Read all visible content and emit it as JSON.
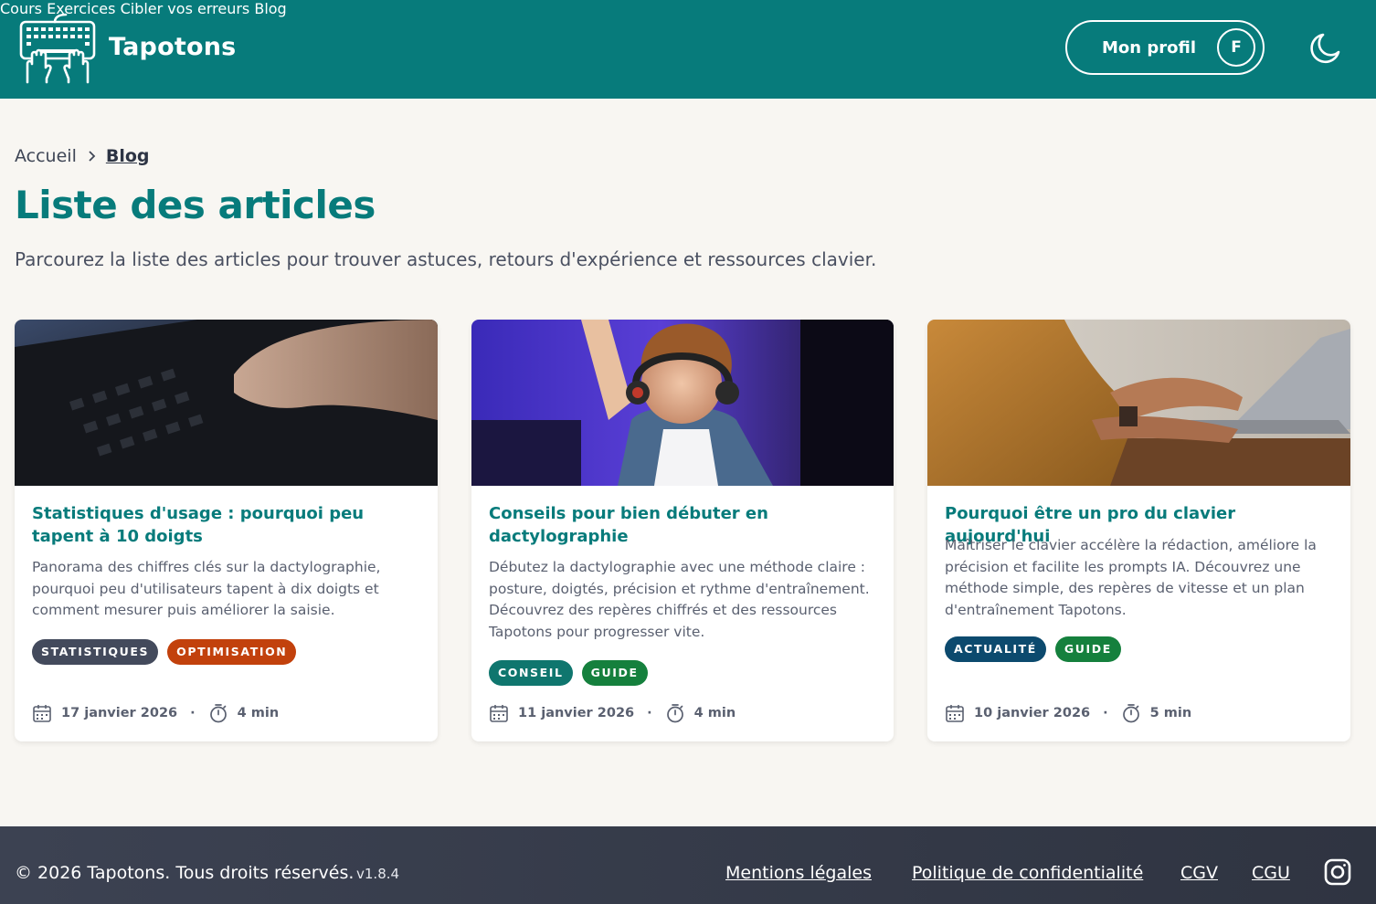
{
  "header": {
    "brand": "Tapotons",
    "nav": [
      "Cours",
      "Exercices",
      "Cibler vos erreurs",
      "Blog"
    ],
    "profile_label": "Mon profil",
    "avatar_initial": "F",
    "theme_icon": "moon-icon"
  },
  "breadcrumb": {
    "home": "Accueil",
    "current": "Blog"
  },
  "page": {
    "title": "Liste des articles",
    "description": "Parcourez la liste des articles pour trouver astuces, retours d'expérience et ressources clavier."
  },
  "articles": [
    {
      "title": "Statistiques d'usage : pourquoi peu tapent à 10 doigts",
      "excerpt": "Panorama des chiffres clés sur la dactylographie, pourquoi peu d'utilisateurs tapent à dix doigts et comment mesurer puis améliorer la saisie.",
      "tags": [
        {
          "label": "STATISTIQUES",
          "color": "#434a5c"
        },
        {
          "label": "OPTIMISATION",
          "color": "#c2410c"
        }
      ],
      "date": "17 janvier 2026",
      "duration": "4 min"
    },
    {
      "title": "Conseils pour bien débuter en dactylographie",
      "excerpt": "Débutez la dactylographie avec une méthode claire : posture, doigtés, précision et rythme d'entraînement. Découvrez des repères chiffrés et des ressources Tapotons pour progresser vite.",
      "tags": [
        {
          "label": "CONSEIL",
          "color": "#0f766e"
        },
        {
          "label": "GUIDE",
          "color": "#15803d"
        }
      ],
      "date": "11 janvier 2026",
      "duration": "4 min"
    },
    {
      "title": "Pourquoi être un pro du clavier aujourd'hui",
      "excerpt": "Maîtriser le clavier accélère la rédaction, améliore la précision et facilite les prompts IA. Découvrez une méthode simple, des repères de vitesse et un plan d'entraînement Tapotons.",
      "tags": [
        {
          "label": "ACTUALITÉ",
          "color": "#0c4a6e"
        },
        {
          "label": "GUIDE",
          "color": "#15803d"
        }
      ],
      "date": "10 janvier 2026",
      "duration": "5 min"
    }
  ],
  "footer": {
    "copyright": "© 2026 Tapotons. Tous droits réservés.",
    "version": "v1.8.4",
    "links": [
      "Mentions légales",
      "Politique de confidentialité",
      "CGV",
      "CGU"
    ],
    "social_icon": "instagram-icon"
  },
  "colors": {
    "primary": "#077b7b",
    "background": "#f8f6f2",
    "footer": "#3c4252"
  }
}
